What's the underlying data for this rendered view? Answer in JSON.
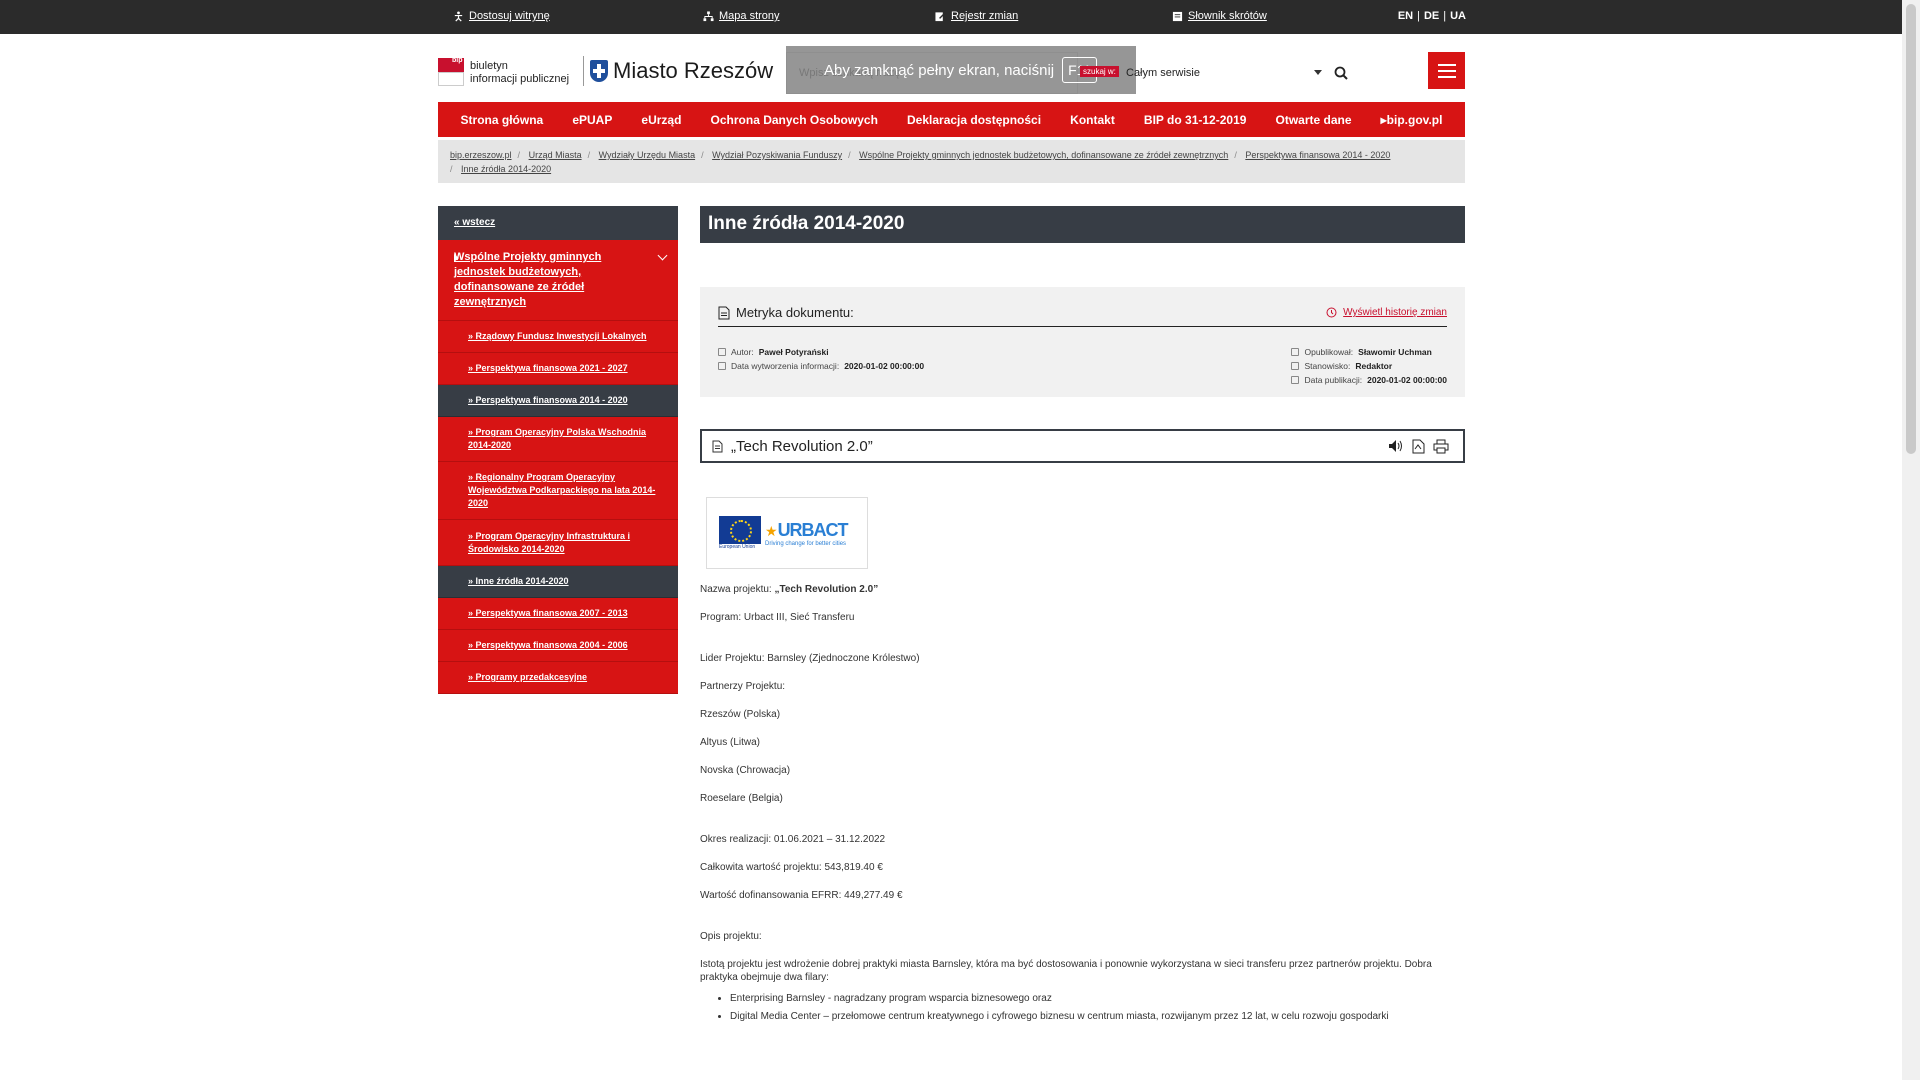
{
  "topbar": {
    "adjust": "Dostosuj witrynę",
    "sitemap": "Mapa strony",
    "changes": "Rejestr zmian",
    "glossary": "Słownik skrótów",
    "lang": [
      "EN",
      "DE",
      "UA"
    ]
  },
  "header": {
    "bip_badge": "bip",
    "bip_line1": "biuletyn",
    "bip_line2": "informacji publicznej",
    "city": "Miasto Rzeszów",
    "search_placeholder": "Wpisz szukaną frazę",
    "fullscreen_msg": "Aby zamknąć pełny ekran, naciśnij",
    "fullscreen_key": "F11",
    "search_in": "szukaj w:",
    "scope": "Całym serwisie"
  },
  "nav": [
    "Strona główna",
    "ePUAP",
    "eUrząd",
    "Ochrona Danych Osobowych",
    "Deklaracja dostępności",
    "Kontakt",
    "BIP do 31-12-2019",
    "Otwarte dane",
    "bip.gov.pl"
  ],
  "breadcrumb": [
    "bip.erzeszow.pl",
    "Urząd Miasta",
    "Wydziały Urzędu Miasta",
    "Wydział Pozyskiwania Funduszy",
    "Wspólne Projekty gminnych jednostek budżetowych, dofinansowane ze źródeł zewnętrznych",
    "Perspektywa finansowa 2014 - 2020",
    "Inne źródła 2014-2020"
  ],
  "sidebar": {
    "back": "« wstecz",
    "parent": "Wspólne Projekty gminnych jednostek budżetowych, dofinansowane ze źródeł zewnętrznych",
    "items": [
      "» Rządowy Fundusz Inwestycji Lokalnych",
      "» Perspektywa finansowa 2021 - 2027",
      "» Perspektywa finansowa 2014 - 2020",
      "» Program Operacyjny Polska Wschodnia 2014-2020",
      "» Regionalny Program Operacyjny Województwa Podkarpackiego na lata 2014-2020",
      "» Program Operacyjny Infrastruktura i Środowisko 2014-2020",
      "» Inne źródła 2014-2020",
      "» Perspektywa finansowa 2007 - 2013",
      "» Perspektywa finansowa 2004 - 2006",
      "» Programy przedakcesyjne"
    ]
  },
  "content": {
    "title": "Inne źródła 2014-2020",
    "meta_title": "Metryka dokumentu:",
    "history_link": "Wyświetl historię zmian",
    "author_label": "Autor:",
    "author": "Paweł Potyrański",
    "created_label": "Data wytworzenia informacji:",
    "created": "2020-01-02 00:00:00",
    "published_by_label": "Opublikował:",
    "published_by": "Sławomir Uchman",
    "position_label": "Stanowisko:",
    "position": "Redaktor",
    "pub_date_label": "Data publikacji:",
    "pub_date": "2020-01-02 00:00:00",
    "doc_title": "„Tech Revolution 2.0”",
    "logo_urbact": "URBACT",
    "logo_eu": "European Union",
    "logo_tagline": "Driving change for better cities",
    "project_name_label": "Nazwa projektu:",
    "project_name": "„Tech Revolution 2.0”",
    "program": "Program: Urbact III, Sieć Transferu",
    "leader": "Lider Projektu: Barnsley (Zjednoczone Królestwo)",
    "partners_label": "Partnerzy Projektu:",
    "partners": [
      "Rzeszów (Polska)",
      "Altyus (Litwa)",
      "Novska (Chrowacja)",
      "Roeselare (Belgia)"
    ],
    "period": "Okres realizacji: 01.06.2021 – 31.12.2022",
    "total": "Całkowita wartość projektu:  543,819.40 €",
    "efrr": "Wartość dofinansowania EFRR: 449,277.49 €",
    "desc_label": "Opis projektu:",
    "desc": "Istotą projektu jest wdrożenie dobrej praktyki miasta Barnsley, która ma być dostosowania i ponownie wykorzystana w sieci transferu przez partnerów projektu. Dobra praktyka obejmuje dwa filary:",
    "bullets": [
      "Enterprising Barnsley - nagradzany program wsparcia biznesowego oraz",
      "Digital Media Center – przełomowe centrum kreatywnego i cyfrowego biznesu w centrum miasta, rozwijanym przez 12 lat, w celu rozwoju gospodarki"
    ]
  },
  "colors": {
    "red": "#d71414",
    "dark": "#373d45",
    "topbar": "#2b2b2b"
  }
}
